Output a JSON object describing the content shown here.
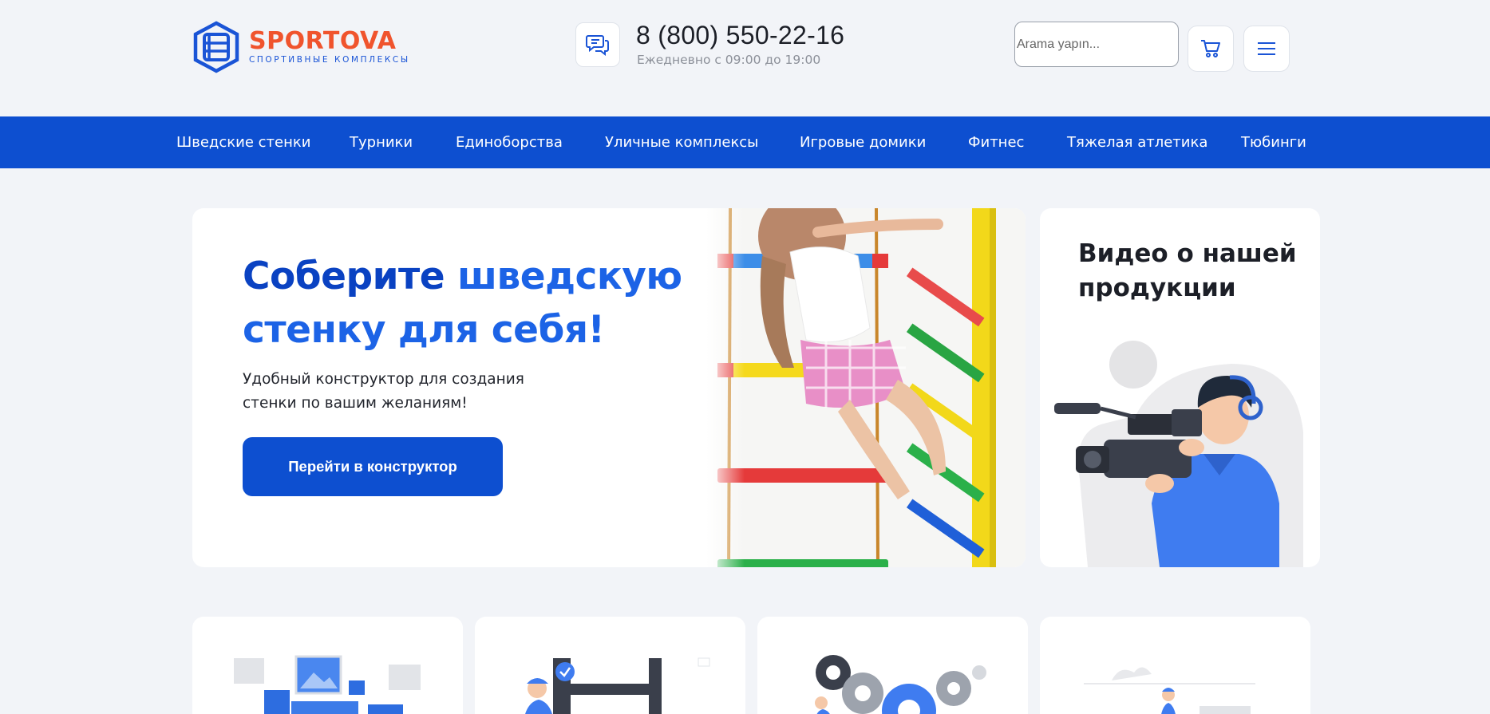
{
  "brand": {
    "name": "SPORTOVA",
    "tagline": "СПОРТИВНЫЕ КОМПЛЕКСЫ"
  },
  "contact": {
    "phone": "8 (800) 550-22-16",
    "hours": "Ежедневно с 09:00 до 19:00"
  },
  "search": {
    "placeholder": "Arama yapın..."
  },
  "nav": {
    "items": [
      {
        "label": "Шведские стенки"
      },
      {
        "label": "Турники"
      },
      {
        "label": "Единоборства"
      },
      {
        "label": "Уличные комплексы"
      },
      {
        "label": "Игровые домики"
      },
      {
        "label": "Фитнес"
      },
      {
        "label": "Тяжелая атлетика"
      },
      {
        "label": "Тюбинги"
      }
    ]
  },
  "hero": {
    "title_part1": "Соберите ",
    "title_part2": "шведскую стенку для себя!",
    "description": "Удобный конструктор для создания стенки по вашим желаниям!",
    "button_label": "Перейти в конструктор"
  },
  "video": {
    "title": "Видео о нашей продукции"
  },
  "icons": {
    "chat": "chat-bubbles-icon",
    "cart": "shopping-cart-icon",
    "menu": "hamburger-menu-icon"
  },
  "colors": {
    "brand_blue": "#0d4fd0",
    "brand_orange": "#f0542d",
    "page_bg": "#f2f4f8"
  }
}
